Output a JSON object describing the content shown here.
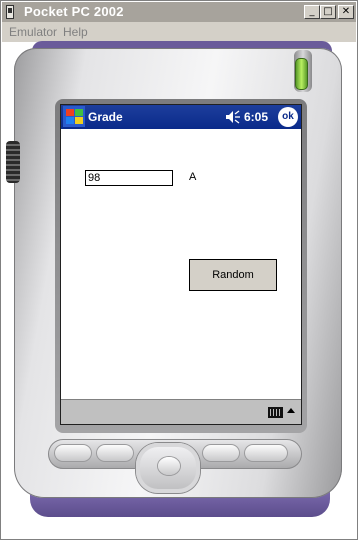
{
  "window": {
    "title": "Pocket PC 2002",
    "controls": [
      "minimize",
      "maximize",
      "close"
    ]
  },
  "menubar": {
    "items": [
      {
        "label": "Emulator"
      },
      {
        "label": "Help"
      }
    ]
  },
  "device": {
    "navbar": {
      "title": "Grade",
      "time": "6:05",
      "ok_label": "ok",
      "icons": [
        "windows-start-icon",
        "speaker-icon"
      ]
    },
    "form": {
      "score_value": "98",
      "grade_label": "A",
      "random_button_label": "Random"
    },
    "taskbar": {
      "icons": [
        "keyboard-icon",
        "input-menu-arrow-icon"
      ]
    }
  },
  "colors": {
    "navbar_bg": "#0a2a8a",
    "device_accent": "#6a5b9a",
    "led": "#8ad040"
  }
}
